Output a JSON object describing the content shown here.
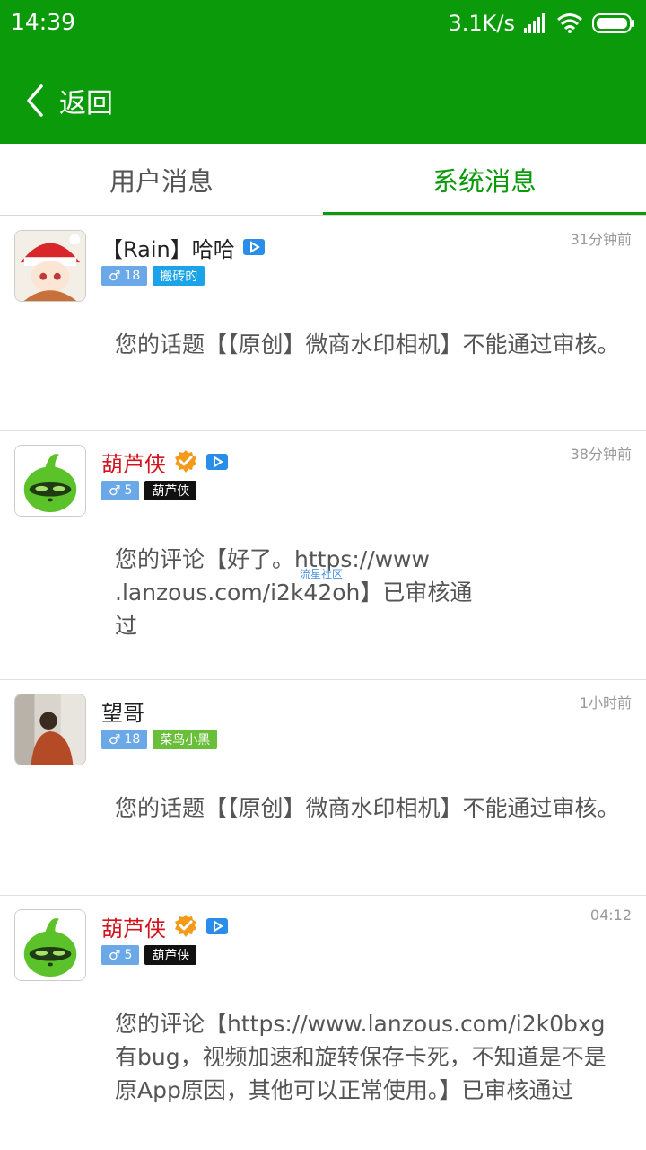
{
  "status": {
    "time": "14:39",
    "speed": "3.1K/s"
  },
  "nav": {
    "back_label": "返回"
  },
  "tabs": [
    {
      "label": "用户消息"
    },
    {
      "label": "系统消息"
    }
  ],
  "watermark": "流星社区",
  "colors": {
    "brand": "#0a9a0a",
    "gender_badge": "#6aa8e8",
    "name_red": "#d2141e"
  },
  "messages": [
    {
      "name": "【Rain】哈哈",
      "level": "18",
      "tag": "搬砖的",
      "tag_color": "#1aa3e8",
      "time": "31分钟前",
      "content": "您的话题【【原创】微商水印相机】不能通过审核。"
    },
    {
      "name": "葫芦侠",
      "level": "5",
      "tag": "葫芦侠",
      "tag_color": "#111111",
      "time": "38分钟前",
      "content_lines": [
        "您的评论【好了。https://www",
        ".lanzous.com/i2k42oh】已审核通",
        "过"
      ]
    },
    {
      "name": "望哥",
      "level": "18",
      "tag": "菜鸟小黑",
      "tag_color": "#6abf3a",
      "time": "1小时前",
      "content": "您的话题【【原创】微商水印相机】不能通过审核。"
    },
    {
      "name": "葫芦侠",
      "level": "5",
      "tag": "葫芦侠",
      "tag_color": "#111111",
      "time": "04:12",
      "content": "您的评论【https://www.lanzous.com/i2k0bxg有bug，视频加速和旋转保存卡死，不知道是不是原App原因，其他可以正常使用。】已审核通过"
    }
  ]
}
